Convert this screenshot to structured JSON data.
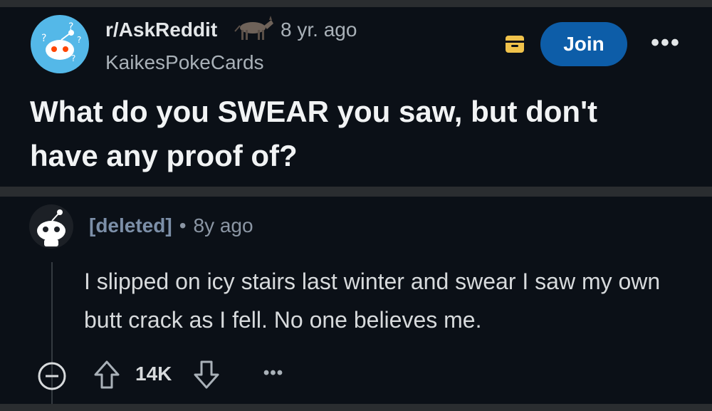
{
  "post": {
    "subreddit": "r/AskReddit",
    "age": "8 yr. ago",
    "author": "KaikesPokeCards",
    "join_label": "Join",
    "more_label": "•••",
    "title": "What do you SWEAR you saw, but don't have any proof of?",
    "icons": {
      "subreddit_avatar": "askreddit-snoo-icon",
      "flair": "donkey-flair-icon",
      "save": "save-icon"
    }
  },
  "comment": {
    "author": "[deleted]",
    "separator": "•",
    "age": "8y ago",
    "body": "I slipped on icy stairs last winter and swear I saw my own butt crack as I fell. No one believes me.",
    "score": "14K",
    "more_label": "•••",
    "icons": {
      "avatar": "deleted-snoo-icon",
      "collapse": "collapse-icon",
      "upvote": "upvote-icon",
      "downvote": "downvote-icon"
    }
  },
  "colors": {
    "background": "#0b1017",
    "separator": "#2a2d30",
    "join_button": "#0d5da8",
    "save_icon": "#f0c24b"
  }
}
